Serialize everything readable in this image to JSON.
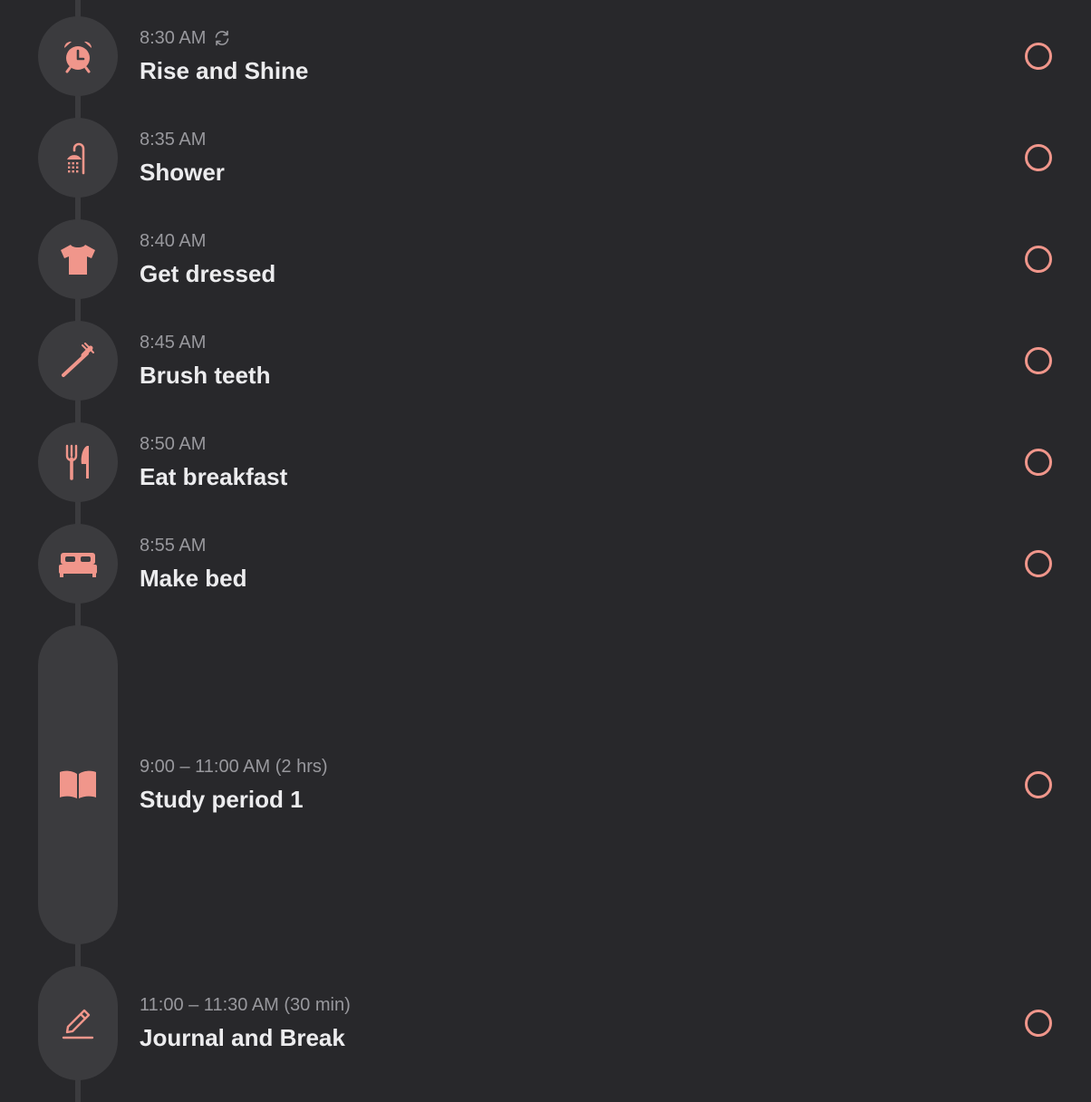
{
  "accent_color": "#f0968b",
  "tasks": [
    {
      "time": "8:30 AM",
      "title": "Rise and Shine",
      "icon": "alarm-clock-icon",
      "repeat_icon": "repeat-icon",
      "completed": false
    },
    {
      "time": "8:35 AM",
      "title": "Shower",
      "icon": "shower-icon",
      "completed": false
    },
    {
      "time": "8:40 AM",
      "title": "Get dressed",
      "icon": "tshirt-icon",
      "completed": false
    },
    {
      "time": "8:45 AM",
      "title": "Brush teeth",
      "icon": "toothbrush-icon",
      "completed": false
    },
    {
      "time": "8:50 AM",
      "title": "Eat breakfast",
      "icon": "fork-knife-icon",
      "completed": false
    },
    {
      "time": "8:55 AM",
      "title": "Make bed",
      "icon": "bed-icon",
      "completed": false
    },
    {
      "time": "9:00 – 11:00 AM (2 hrs)",
      "title": "Study period 1",
      "icon": "book-icon",
      "completed": false
    },
    {
      "time": "11:00 – 11:30 AM (30 min)",
      "title": "Journal and Break",
      "icon": "pencil-icon",
      "completed": false
    }
  ]
}
